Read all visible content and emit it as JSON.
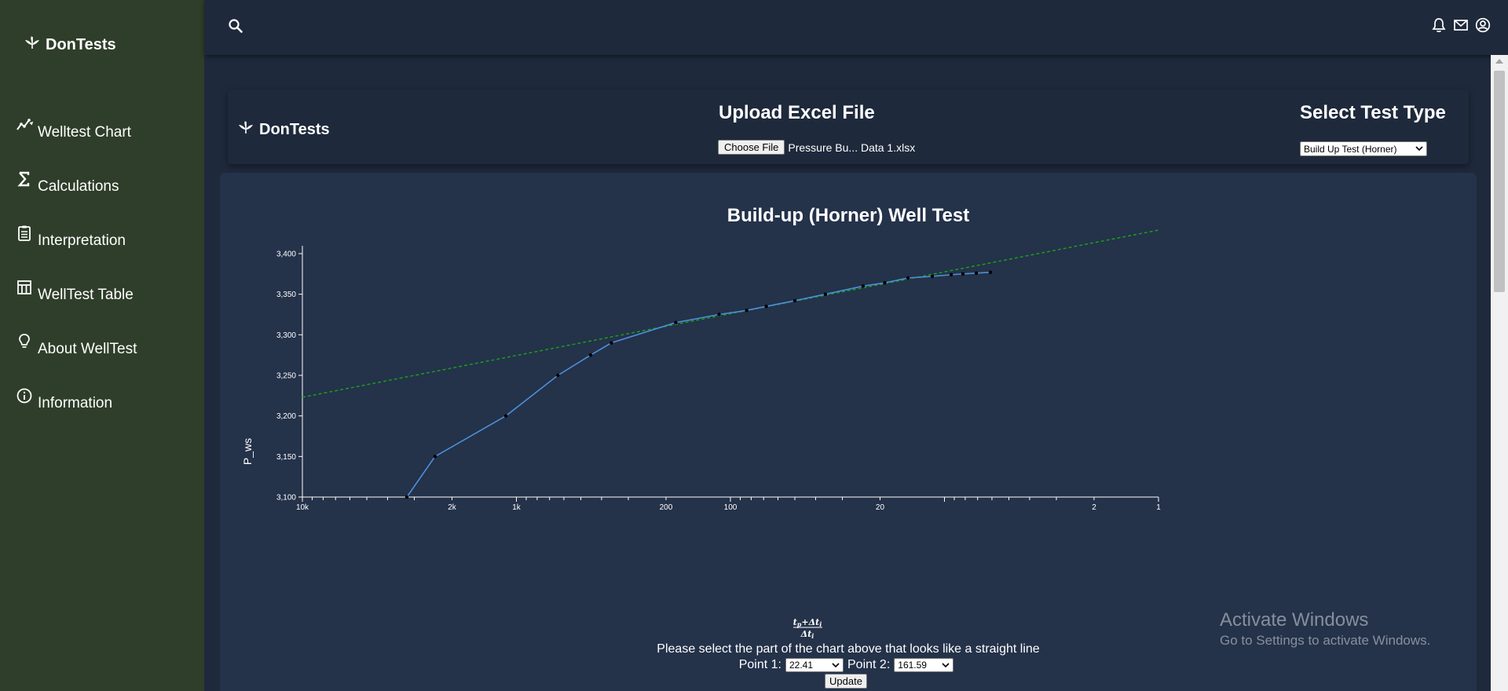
{
  "sidebar": {
    "brand": "DonTests",
    "items": [
      {
        "label": "Welltest Chart",
        "icon": "chart-line-icon"
      },
      {
        "label": "Calculations",
        "icon": "sigma-icon"
      },
      {
        "label": "Interpretation",
        "icon": "clipboard-icon"
      },
      {
        "label": "WellTest Table",
        "icon": "table-icon"
      },
      {
        "label": "About WellTest",
        "icon": "lightbulb-icon"
      },
      {
        "label": "Information",
        "icon": "info-icon"
      }
    ]
  },
  "topbar": {
    "icons": [
      "search-icon",
      "bell-icon",
      "mail-icon",
      "user-icon"
    ]
  },
  "upload_panel": {
    "brand": "DonTests",
    "upload_title": "Upload Excel File",
    "choose_file_label": "Choose File",
    "file_name": "Pressure Bu... Data 1.xlsx",
    "test_type_title": "Select Test Type",
    "test_type_selected": "Build Up Test (Horner)"
  },
  "chart_section": {
    "title": "Build-up (Horner) Well Test",
    "instructions": "Please select the part of the chart above that looks like a straight line",
    "point1_label": "Point 1:",
    "point1_value": "22.41",
    "point2_label": "Point 2:",
    "point2_value": "161.59",
    "update_label": "Update"
  },
  "chart_data": {
    "type": "line",
    "ylabel": "P_ws",
    "xlabel": "(tp+Δti)/Δti",
    "x_scale": "log",
    "x_reversed": true,
    "xlim": [
      10000,
      1
    ],
    "ylim": [
      3100,
      3430
    ],
    "x_ticks": [
      "10k",
      "2k",
      "1k",
      "200",
      "100",
      "20",
      "2",
      "1"
    ],
    "y_ticks": [
      "3,100",
      "3,150",
      "3,200",
      "3,250",
      "3,300",
      "3,350",
      "3,400"
    ],
    "series": [
      {
        "points": [
          [
            3250,
            3100
          ],
          [
            2400,
            3150
          ],
          [
            1120,
            3200
          ],
          [
            640,
            3250
          ],
          [
            450,
            3275
          ],
          [
            360,
            3290
          ],
          [
            180,
            3315
          ],
          [
            113,
            3325
          ],
          [
            84,
            3330
          ],
          [
            68,
            3335
          ],
          [
            50,
            3342
          ],
          [
            36,
            3350
          ],
          [
            24,
            3360
          ],
          [
            19,
            3364
          ],
          [
            14.8,
            3370
          ],
          [
            11.4,
            3372
          ],
          [
            9.3,
            3374
          ],
          [
            8.2,
            3375
          ],
          [
            7.1,
            3376
          ],
          [
            6.1,
            3377
          ]
        ]
      }
    ],
    "trendline": {
      "style": "dashed",
      "color": "#1a9e1a",
      "endpoints": [
        [
          10000,
          3223
        ],
        [
          1,
          3429
        ]
      ]
    },
    "grid": false
  },
  "colors": {
    "sidebar_bg": "#2f3e2a",
    "main_bg": "#1e293b",
    "card_bg": "#24324a",
    "line": "#4d8fd6",
    "trendline": "#1a9e1a"
  },
  "watermark": {
    "title": "Activate Windows",
    "subtitle": "Go to Settings to activate Windows."
  }
}
